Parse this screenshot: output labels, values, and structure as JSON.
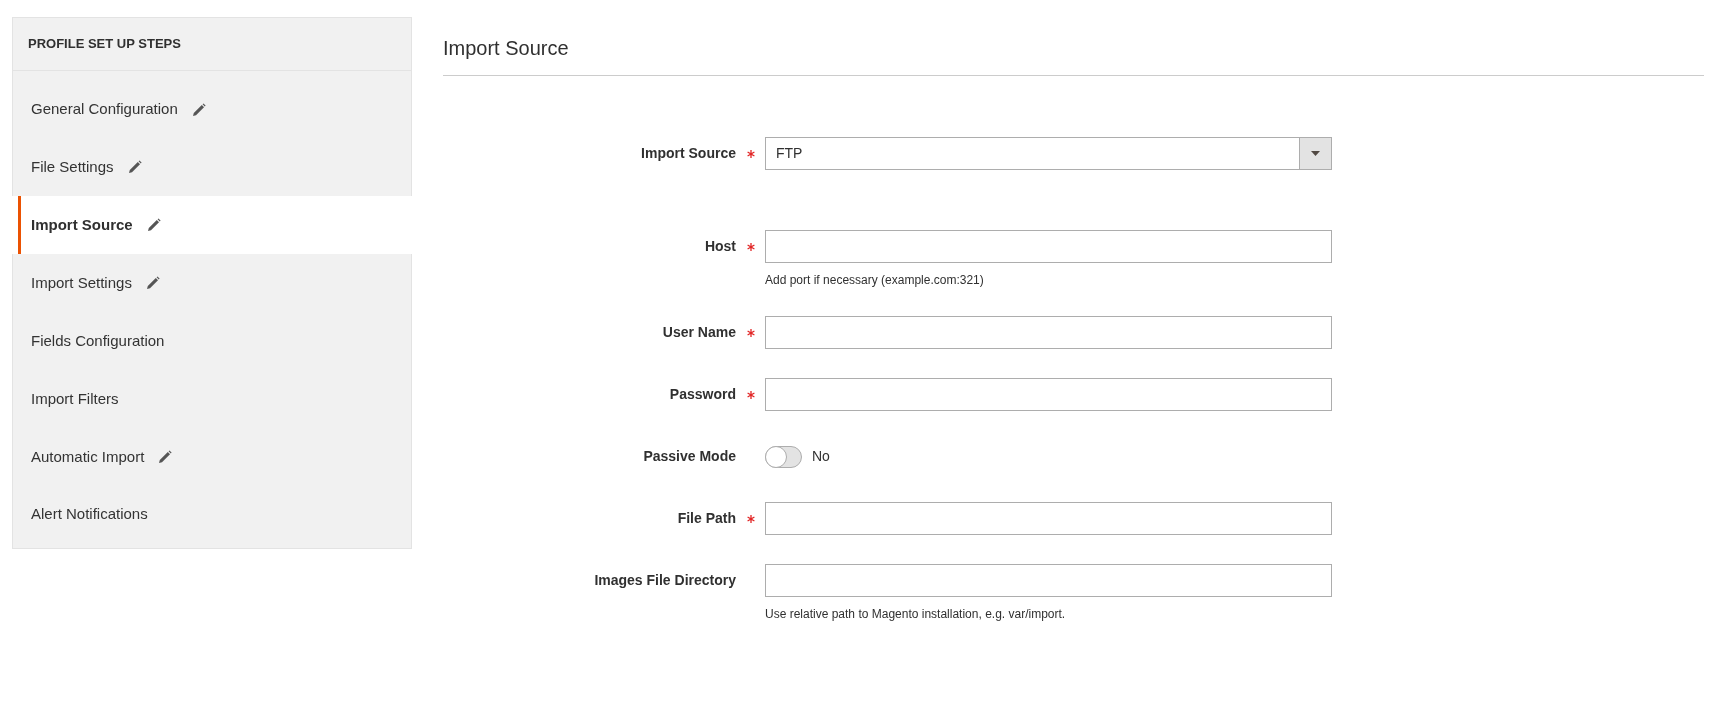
{
  "sidebar": {
    "title": "PROFILE SET UP STEPS",
    "items": [
      {
        "label": "General Configuration",
        "edited": true,
        "selected": false
      },
      {
        "label": "File Settings",
        "edited": true,
        "selected": false
      },
      {
        "label": "Import Source",
        "edited": true,
        "selected": true
      },
      {
        "label": "Import Settings",
        "edited": true,
        "selected": false
      },
      {
        "label": "Fields Configuration",
        "edited": false,
        "selected": false
      },
      {
        "label": "Import Filters",
        "edited": false,
        "selected": false
      },
      {
        "label": "Automatic Import",
        "edited": true,
        "selected": false
      },
      {
        "label": "Alert Notifications",
        "edited": false,
        "selected": false
      }
    ]
  },
  "section": {
    "title": "Import Source",
    "fields": [
      {
        "kind": "select",
        "label": "Import Source",
        "required": true,
        "value": "FTP"
      },
      {
        "kind": "text",
        "label": "Host",
        "required": true,
        "hint": "Add port if necessary (example.com:321)"
      },
      {
        "kind": "text",
        "label": "User Name",
        "required": true
      },
      {
        "kind": "text",
        "label": "Password",
        "required": true
      },
      {
        "kind": "toggle",
        "label": "Passive Mode",
        "required": false,
        "on": false,
        "state_label": "No"
      },
      {
        "kind": "text",
        "label": "File Path",
        "required": true
      },
      {
        "kind": "text",
        "label": "Images File Directory",
        "required": false,
        "hint": "Use relative path to Magento installation, e.g. var/import."
      }
    ]
  }
}
